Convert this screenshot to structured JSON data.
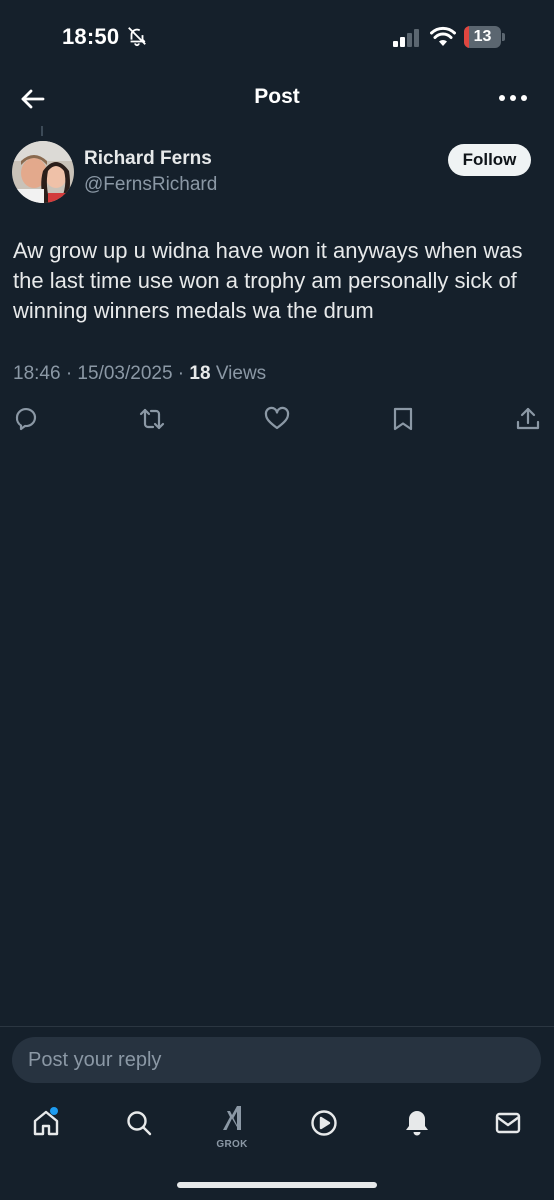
{
  "status_bar": {
    "time": "18:50",
    "battery_level": "13",
    "battery_fraction": 0.13,
    "icons": [
      "bell-slash-icon",
      "cellular-signal-icon",
      "wifi-icon",
      "battery-icon"
    ]
  },
  "header": {
    "title": "Post",
    "back_icon": "arrow-left-icon",
    "more_icon": "more-horizontal-icon"
  },
  "post": {
    "author_name": "Richard Ferns",
    "author_handle": "@FernsRichard",
    "follow_label": "Follow",
    "text": "Aw grow up u widna have won it anyways when was the last time use won a trophy am personally sick of winning winners medals wa the drum",
    "timestamp": "18:46 · 15/03/2025 · ",
    "views_count": "18",
    "views_label": " Views",
    "actions": [
      "reply-icon",
      "repost-icon",
      "like-icon",
      "bookmark-icon",
      "share-icon"
    ]
  },
  "reply": {
    "placeholder": "Post your reply"
  },
  "tab_bar": {
    "items": [
      "home-icon",
      "search-icon",
      "grok-icon",
      "video-icon",
      "notifications-icon",
      "messages-icon"
    ],
    "grok_label": "GROK"
  },
  "colors": {
    "background": "#15202b",
    "text_primary": "#e7e9ea",
    "text_secondary": "#8b98a5",
    "accent": "#1d9bf0",
    "battery_low": "#e0463f"
  }
}
